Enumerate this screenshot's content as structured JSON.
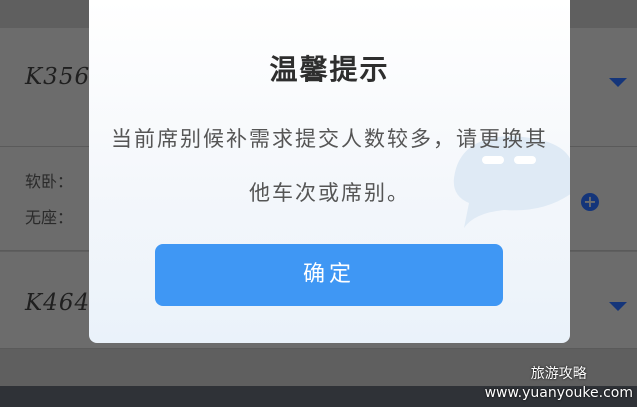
{
  "background": {
    "cards": [
      {
        "train_no": "K356",
        "seats": [
          "软卧：",
          "无座："
        ]
      },
      {
        "train_no": "K464"
      }
    ]
  },
  "dialog": {
    "title": "温馨提示",
    "message": "当前席别候补需求提交人数较多，请更换其他车次或席别。",
    "confirm_label": "确定"
  },
  "watermark": {
    "line1": "旅游攻略",
    "line2": "www.yuanyouke.com"
  },
  "colors": {
    "confirm_button": "#3f97f4",
    "accent": "#14357a"
  }
}
